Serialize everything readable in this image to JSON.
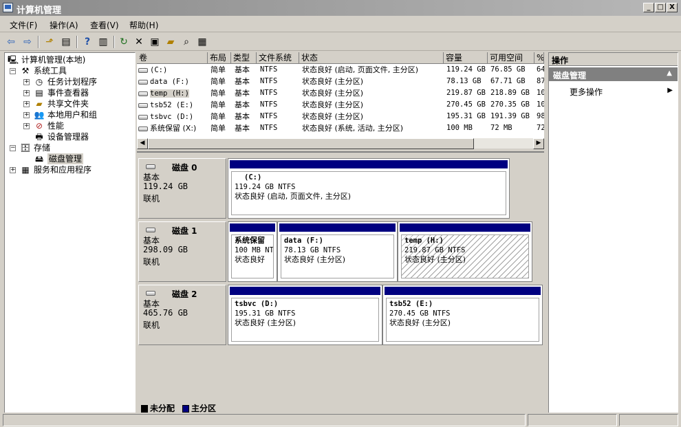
{
  "window": {
    "title": "计算机管理",
    "buttons": {
      "minimize": "_",
      "restore": "□",
      "close": "X"
    }
  },
  "menu": [
    "文件(F)",
    "操作(A)",
    "查看(V)",
    "帮助(H)"
  ],
  "tree": {
    "root": "计算机管理(本地)",
    "system_tools": "系统工具",
    "task_scheduler": "任务计划程序",
    "event_viewer": "事件查看器",
    "shared_folders": "共享文件夹",
    "local_users": "本地用户和组",
    "performance": "性能",
    "device_manager": "设备管理器",
    "storage": "存储",
    "disk_management": "磁盘管理",
    "services_apps": "服务和应用程序",
    "expand_plus": "+",
    "expand_minus": "−"
  },
  "volume_table": {
    "headers": [
      "卷",
      "布局",
      "类型",
      "文件系统",
      "状态",
      "容量",
      "可用空间",
      "%"
    ],
    "rows": [
      [
        "(C:)",
        "简单",
        "基本",
        "NTFS",
        "状态良好 (启动, 页面文件, 主分区)",
        "119.24 GB",
        "76.85 GB",
        "64"
      ],
      [
        "data (F:)",
        "简单",
        "基本",
        "NTFS",
        "状态良好 (主分区)",
        "78.13 GB",
        "67.71 GB",
        "87"
      ],
      [
        "temp (H:)",
        "简单",
        "基本",
        "NTFS",
        "状态良好 (主分区)",
        "219.87 GB",
        "218.89 GB",
        "10"
      ],
      [
        "tsb52 (E:)",
        "简单",
        "基本",
        "NTFS",
        "状态良好 (主分区)",
        "270.45 GB",
        "270.35 GB",
        "10"
      ],
      [
        "tsbvc (D:)",
        "简单",
        "基本",
        "NTFS",
        "状态良好 (主分区)",
        "195.31 GB",
        "191.39 GB",
        "98"
      ],
      [
        "系统保留 (X:)",
        "简单",
        "基本",
        "NTFS",
        "状态良好 (系统, 活动, 主分区)",
        "100 MB",
        "72 MB",
        "72"
      ]
    ]
  },
  "disks": [
    {
      "name": "磁盘 0",
      "type": "基本",
      "size": "119.24 GB",
      "status": "联机",
      "partitions": [
        {
          "name": "(C:)",
          "size": "119.24 GB NTFS",
          "status": "状态良好 (启动, 页面文件, 主分区)"
        }
      ]
    },
    {
      "name": "磁盘 1",
      "type": "基本",
      "size": "298.09 GB",
      "status": "联机",
      "partitions": [
        {
          "name": "系统保留",
          "size": "100 MB NT",
          "status": "状态良好"
        },
        {
          "name": "data  (F:)",
          "size": "78.13 GB NTFS",
          "status": "状态良好 (主分区)"
        },
        {
          "name": "temp  (H:)",
          "size": "219.87 GB NTFS",
          "status": "状态良好 (主分区)"
        }
      ]
    },
    {
      "name": "磁盘 2",
      "type": "基本",
      "size": "465.76 GB",
      "status": "联机",
      "partitions": [
        {
          "name": "tsbvc  (D:)",
          "size": "195.31 GB NTFS",
          "status": "状态良好 (主分区)"
        },
        {
          "name": "tsb52  (E:)",
          "size": "270.45 GB NTFS",
          "status": "状态良好 (主分区)"
        }
      ]
    }
  ],
  "legend": {
    "unallocated": "未分配",
    "primary": "主分区"
  },
  "actions": {
    "header": "操作",
    "section": "磁盘管理",
    "more": "更多操作",
    "collapse_arrow": "▲",
    "more_arrow": "▶"
  },
  "colors": {
    "primary_partition": "#000080",
    "unallocated": "#000000"
  }
}
